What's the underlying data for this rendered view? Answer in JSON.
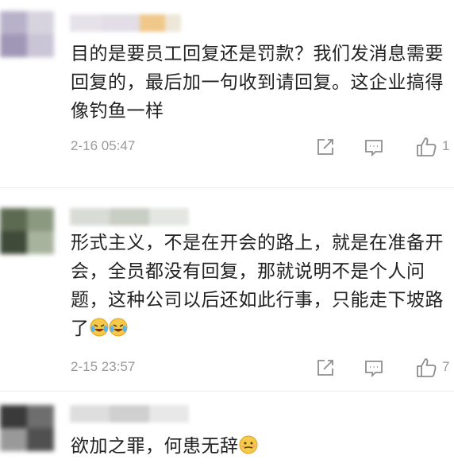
{
  "comments": [
    {
      "text": "目的是要员工回复还是罚款？我们发消息需要回复的，最后加一句收到请回复。这企业搞得像钓鱼一样",
      "time": "2-16 05:47",
      "likes": "1",
      "emoji": "",
      "avatar_palette": [
        "#b7b1c9",
        "#d6d2de",
        "#9f97b6",
        "#c9c4d6"
      ],
      "username_palette": [
        "#e6e2ea",
        "#f0c98a",
        "#d8d4dc"
      ]
    },
    {
      "text": "形式主义，不是在开会的路上，就是在准备开会，全员都没有回复，那就说明不是个人问题，这种公司以后还如此行事，只能走下坡路了",
      "time": "2-15 23:57",
      "likes": "7",
      "emoji": "cry-laugh-emoji cry-laugh-emoji",
      "avatar_palette": [
        "#5d6a52",
        "#8a9980",
        "#3f4a38",
        "#a8b39e"
      ],
      "username_palette": [
        "#d9dcd6",
        "#c9cec4",
        "#e4e6e1"
      ]
    },
    {
      "text": "欲加之罪，何患无辞",
      "time": "",
      "likes": "",
      "emoji": "awkward-smile-emoji",
      "avatar_palette": [
        "#3a3a3a",
        "#6e6e6e",
        "#999999",
        "#505050"
      ],
      "username_palette": [
        "#dedede",
        "#cfcfcf",
        "#e8e8e8"
      ]
    }
  ]
}
